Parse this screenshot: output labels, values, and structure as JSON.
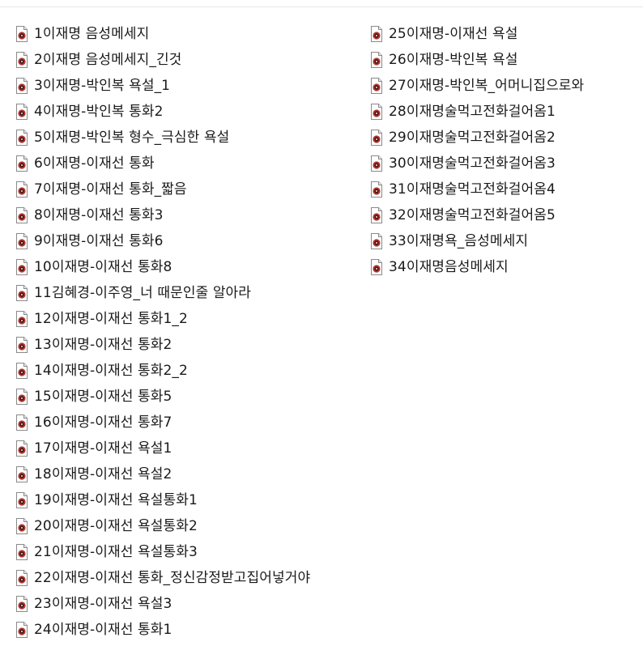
{
  "icon": "audio-file-icon",
  "colors": {
    "icon_accent": "#b0352f",
    "icon_page": "#ffffff",
    "icon_border": "#8a8a8a",
    "text": "#1a1a1a"
  },
  "files_left": [
    "1이재명 음성메세지",
    "2이재명 음성메세지_긴것",
    "3이재명-박인복 욕설_1",
    "4이재명-박인복 통화2",
    "5이재명-박인복 형수_극심한 욕설",
    "6이재명-이재선 통화",
    "7이재명-이재선 통화_짧음",
    "8이재명-이재선 통화3",
    "9이재명-이재선 통화6",
    "10이재명-이재선 통화8",
    "11김혜경-이주영_너 때문인줄 알아라",
    "12이재명-이재선 통화1_2",
    "13이재명-이재선 통화2",
    "14이재명-이재선 통화2_2",
    "15이재명-이재선 통화5",
    "16이재명-이재선 통화7",
    "17이재명-이재선 욕설1",
    "18이재명-이재선 욕설2",
    "19이재명-이재선 욕설통화1",
    "20이재명-이재선 욕설통화2",
    "21이재명-이재선 욕설통화3",
    "22이재명-이재선 통화_정신감정받고집어넣거야",
    "23이재명-이재선 욕설3",
    "24이재명-이재선 통화1"
  ],
  "files_right": [
    "25이재명-이재선 욕설",
    "26이재명-박인복 욕설",
    "27이재명-박인복_어머니집으로와",
    "28이재명술먹고전화걸어옴1",
    "29이재명술먹고전화걸어옴2",
    "30이재명술먹고전화걸어옴3",
    "31이재명술먹고전화걸어옴4",
    "32이재명술먹고전화걸어옴5",
    "33이재명욕_음성메세지",
    "34이재명음성메세지"
  ]
}
